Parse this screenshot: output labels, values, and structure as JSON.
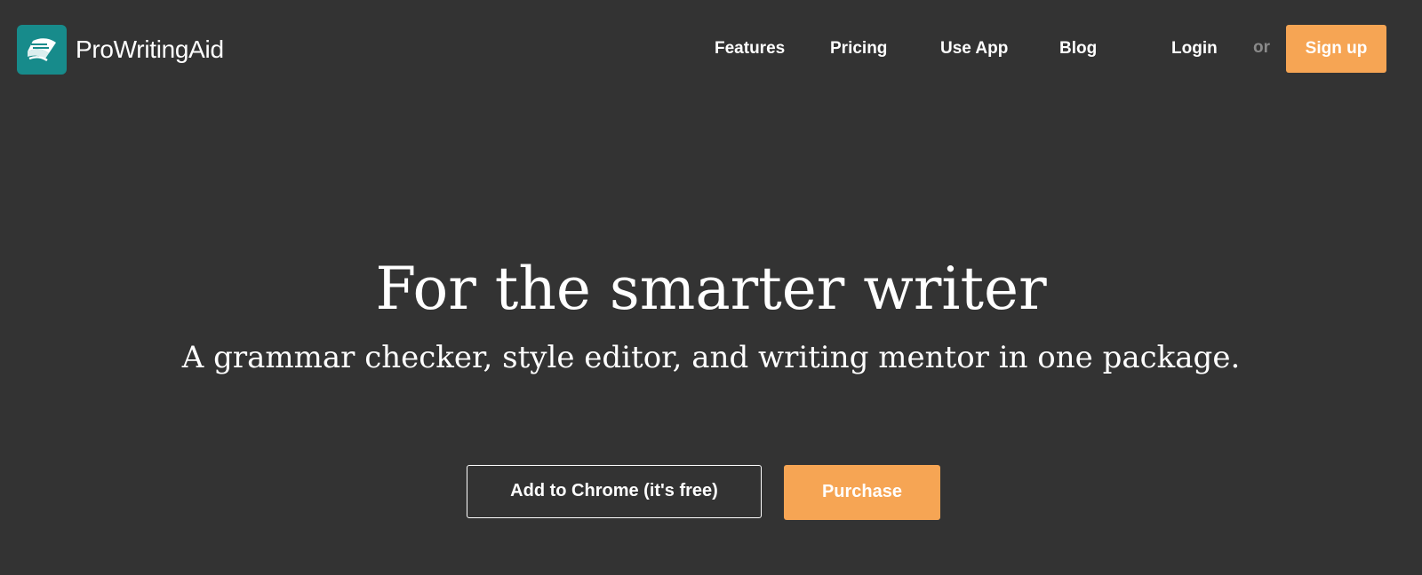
{
  "header": {
    "brand": {
      "name": "ProWritingAid",
      "icon": "book-pages-icon",
      "icon_color": "#178b8b"
    },
    "nav": [
      {
        "label": "Features"
      },
      {
        "label": "Pricing"
      },
      {
        "label": "Use App"
      },
      {
        "label": "Blog"
      }
    ],
    "login_label": "Login",
    "or_label": "or",
    "signup_label": "Sign up"
  },
  "hero": {
    "title": "For the smarter writer",
    "subtitle": "A grammar checker, style editor, and writing mentor in one package.",
    "secondary_cta": "Add to Chrome (it's free)",
    "primary_cta": "Purchase"
  },
  "colors": {
    "background": "#333333",
    "accent": "#f6a554",
    "brand": "#178b8b",
    "text": "#ffffff",
    "muted": "#8a8a8a"
  }
}
